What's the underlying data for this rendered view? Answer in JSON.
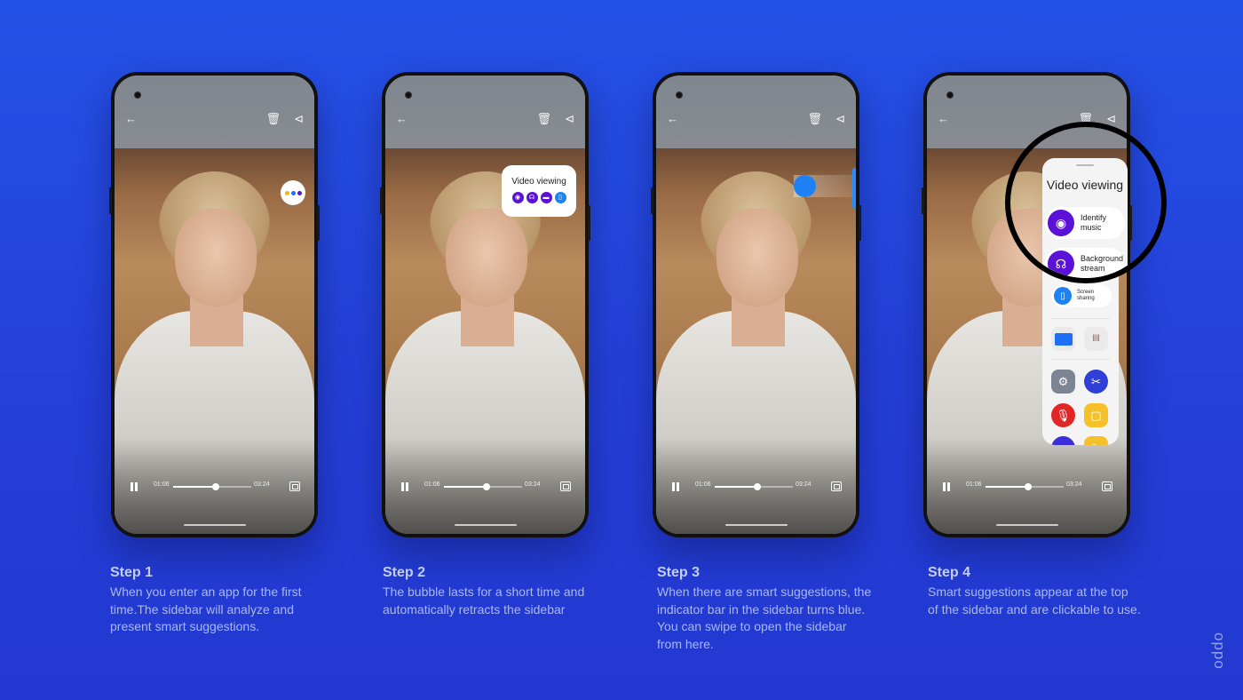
{
  "brand": {
    "logo_text": "oppo"
  },
  "colors": {
    "background": "#2441d8",
    "accent_blue": "#1e82f5",
    "purple": "#5b12d6",
    "dot_yellow": "#f5b800",
    "dot_blue": "#1e6ff5",
    "dot_purple": "#5b12d6"
  },
  "player": {
    "current_time": "01:06",
    "total_time": "03:24",
    "progress_fraction": 0.55,
    "icons": [
      "back-arrow-icon",
      "trash-icon",
      "share-icon",
      "pause-icon",
      "fullscreen-icon"
    ]
  },
  "steps": [
    {
      "title": "Step 1",
      "text": "When you enter an app for the first time.The sidebar will analyze and present smart suggestions."
    },
    {
      "title": "Step 2",
      "text": "The bubble lasts for a short time and automatically retracts the sidebar"
    },
    {
      "title": "Step 3",
      "text": "When there are smart suggestions, the indicator bar in the sidebar turns blue. You can swipe to open the sidebar from here."
    },
    {
      "title": "Step 4",
      "text": "Smart suggestions appear at the top of the sidebar and are clickable to use."
    }
  ],
  "bubble": {
    "title": "Video viewing",
    "icons": [
      "music-identify-icon",
      "headphones-icon",
      "screen-icon",
      "screen-share-icon"
    ]
  },
  "sidebar": {
    "title": "Video viewing",
    "suggestions": [
      {
        "label_line1": "Identify",
        "label_line2": "music",
        "icon": "music-identify-icon"
      },
      {
        "label_line1": "Background",
        "label_line2": "stream",
        "icon": "headphones-icon"
      },
      {
        "label_line1": "Screen",
        "label_line2": "sharing",
        "icon": "screen-share-icon"
      }
    ],
    "apps": [
      "files-app",
      "voice-recorder-app",
      "settings-app",
      "screenshot-app",
      "microphone-app",
      "book-app",
      "music-app",
      "notes-app"
    ]
  }
}
